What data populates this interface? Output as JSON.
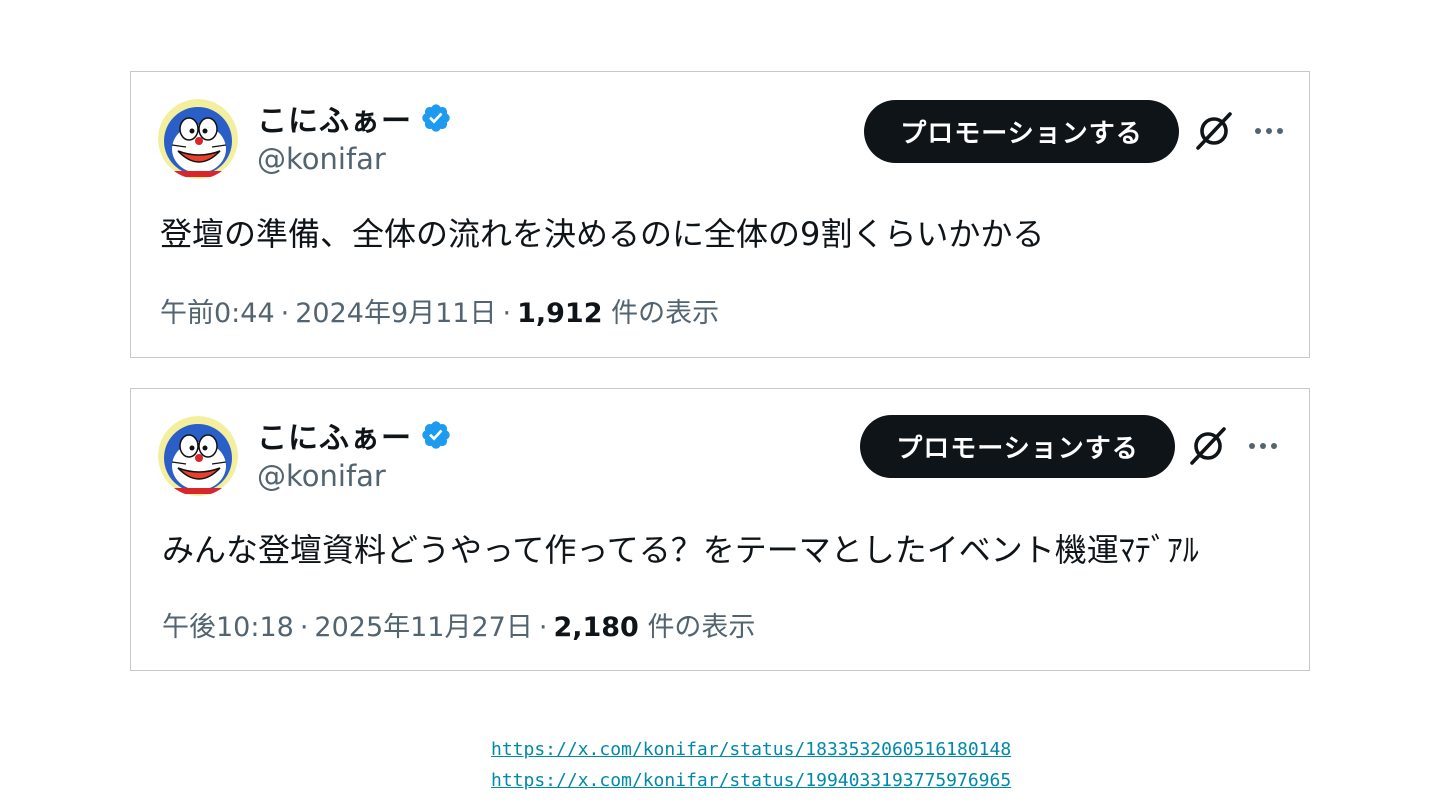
{
  "tweets": [
    {
      "display_name": "こにふぁー",
      "handle": "@konifar",
      "promote_label": "プロモーションする",
      "text": "登壇の準備、全体の流れを決めるのに全体の9割くらいかかる",
      "time": "午前0:44",
      "date": "2024年9月11日",
      "views": "1,912",
      "views_suffix": "件の表示"
    },
    {
      "display_name": "こにふぁー",
      "handle": "@konifar",
      "promote_label": "プロモーションする",
      "text": "みんな登壇資料どうやって作ってる？をテーマとしたイベント機運ﾏﾃﾞｱﾙ",
      "time": "午後10:18",
      "date": "2025年11月27日",
      "views": "2,180",
      "views_suffix": "件の表示"
    }
  ],
  "links": [
    "https://x.com/konifar/status/1833532060516180148",
    "https://x.com/konifar/status/1994033193775976965"
  ],
  "icons": {
    "verified": "verified-badge-icon",
    "grok": "grok-icon",
    "more": "more-icon"
  },
  "colors": {
    "verified_blue": "#1d9bf0",
    "button_bg": "#0f1419",
    "secondary_text": "#536471",
    "link": "#008aa8"
  }
}
